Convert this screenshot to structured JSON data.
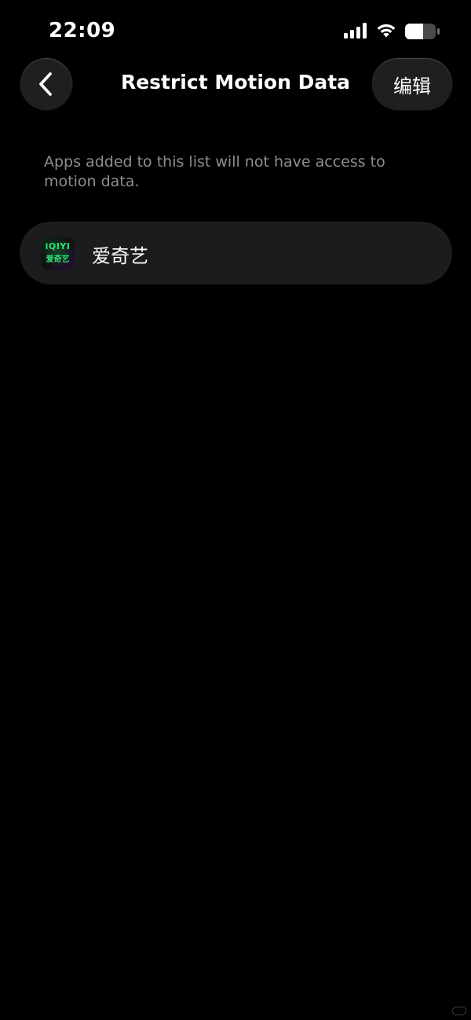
{
  "status_bar": {
    "time": "22:09",
    "signal_icon": "cellular-signal-icon",
    "wifi_icon": "wifi-icon",
    "battery_icon": "battery-icon"
  },
  "nav": {
    "back_icon": "chevron-left-icon",
    "title": "Restrict Motion Data",
    "edit_label": "编辑"
  },
  "description": "Apps added to this list will not have access to motion data.",
  "apps": [
    {
      "name": "爱奇艺",
      "icon": "iqiyi-app-icon",
      "icon_text_top": "iQIYI",
      "icon_text_bottom": "爱奇艺"
    }
  ],
  "colors": {
    "background": "#000000",
    "card": "#1c1c1e",
    "secondary_text": "#8d8d93",
    "iqiyi_green": "#2fe27a"
  }
}
